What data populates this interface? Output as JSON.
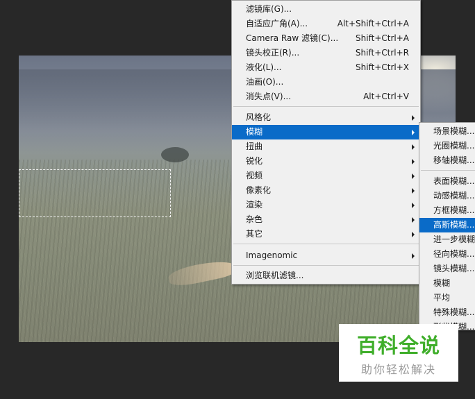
{
  "filter_menu": {
    "items": [
      {
        "label": "滤镜库(G)...",
        "shortcut": ""
      },
      {
        "label": "自适应广角(A)...",
        "shortcut": "Alt+Shift+Ctrl+A"
      },
      {
        "label": "Camera Raw 滤镜(C)...",
        "shortcut": "Shift+Ctrl+A"
      },
      {
        "label": "镜头校正(R)...",
        "shortcut": "Shift+Ctrl+R"
      },
      {
        "label": "液化(L)...",
        "shortcut": "Shift+Ctrl+X"
      },
      {
        "label": "油画(O)...",
        "shortcut": ""
      },
      {
        "label": "消失点(V)...",
        "shortcut": "Alt+Ctrl+V"
      }
    ],
    "groups": [
      {
        "label": "风格化"
      },
      {
        "label": "模糊"
      },
      {
        "label": "扭曲"
      },
      {
        "label": "锐化"
      },
      {
        "label": "视频"
      },
      {
        "label": "像素化"
      },
      {
        "label": "渲染"
      },
      {
        "label": "杂色"
      },
      {
        "label": "其它"
      }
    ],
    "plugin": {
      "label": "Imagenomic"
    },
    "browse": {
      "label": "浏览联机滤镜..."
    }
  },
  "blur_submenu": {
    "items": [
      {
        "label": "场景模糊..."
      },
      {
        "label": "光圈模糊..."
      },
      {
        "label": "移轴模糊..."
      },
      {
        "label": "表面模糊..."
      },
      {
        "label": "动感模糊..."
      },
      {
        "label": "方框模糊..."
      },
      {
        "label": "高斯模糊..."
      },
      {
        "label": "进一步模糊"
      },
      {
        "label": "径向模糊..."
      },
      {
        "label": "镜头模糊..."
      },
      {
        "label": "模糊"
      },
      {
        "label": "平均"
      },
      {
        "label": "特殊模糊..."
      },
      {
        "label": "形状模糊..."
      }
    ]
  },
  "watermark": {
    "title": "百科全说",
    "subtitle": "助你轻松解决"
  },
  "colors": {
    "highlight": "#0a6bc8",
    "menu_bg": "#f0f0f0",
    "workspace": "#282828",
    "watermark_green": "#3fae2a"
  }
}
